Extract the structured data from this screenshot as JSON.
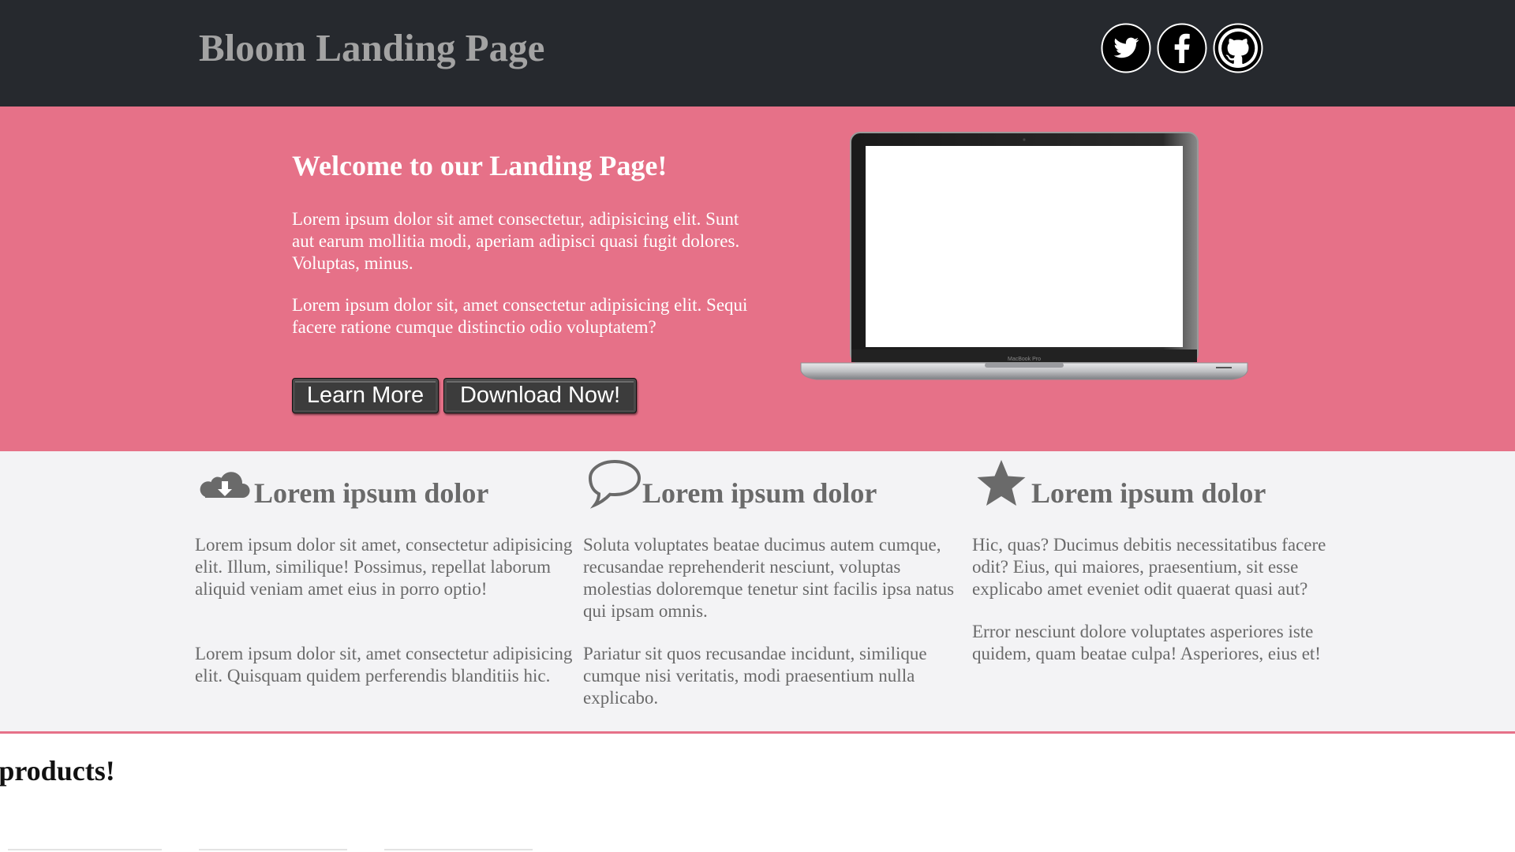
{
  "header": {
    "title": "Bloom Landing Page",
    "social": [
      {
        "name": "twitter-icon"
      },
      {
        "name": "facebook-icon"
      },
      {
        "name": "github-icon"
      }
    ]
  },
  "hero": {
    "title": "Welcome to our Landing Page!",
    "paragraph1": "Lorem ipsum dolor sit amet consectetur, adipisicing elit. Sunt aut earum mollitia modi, aperiam adipisci quasi fugit dolores. Voluptas, minus.",
    "paragraph2": "Lorem ipsum dolor sit, amet consectetur adipisicing elit. Sequi facere ratione cumque distinctio odio voluptatem?",
    "learn_more_label": "Learn More",
    "download_label": "Download Now!",
    "laptop_label": "MacBook Pro"
  },
  "features": [
    {
      "icon": "cloud-download-icon",
      "title": "Lorem ipsum dolor",
      "p1": "Lorem ipsum dolor sit amet, consectetur adipisicing elit. Illum, similique! Possimus, repellat laborum aliquid veniam amet eius in porro optio!",
      "p2": "Lorem ipsum dolor sit, amet consectetur adipisicing elit. Quisquam quidem perferendis blanditiis hic."
    },
    {
      "icon": "speech-bubble-icon",
      "title": "Lorem ipsum dolor",
      "p1": "Soluta voluptates beatae ducimus autem cumque, recusandae reprehenderit nesciunt, voluptas molestias doloremque tenetur sint facilis ipsa natus qui ipsam omnis.",
      "p2": "Pariatur sit quos recusandae incidunt, similique cumque nisi veritatis, modi praesentium nulla explicabo."
    },
    {
      "icon": "star-icon",
      "title": "Lorem ipsum dolor",
      "p1": "Hic, quas? Ducimus debitis necessitatibus facere odit? Eius, qui maiores, praesentium, sit esse explicabo amet eveniet odit quaerat quasi aut?",
      "p2": "Error nesciunt dolore voluptates asperiores iste quidem, quam beatae culpa! Asperiores, eius et!"
    }
  ],
  "products": {
    "heading": "r products!"
  },
  "colors": {
    "header_bg": "#26292e",
    "hero_bg": "#e67188",
    "features_bg": "#f3f3f5",
    "accent": "#e67188"
  }
}
